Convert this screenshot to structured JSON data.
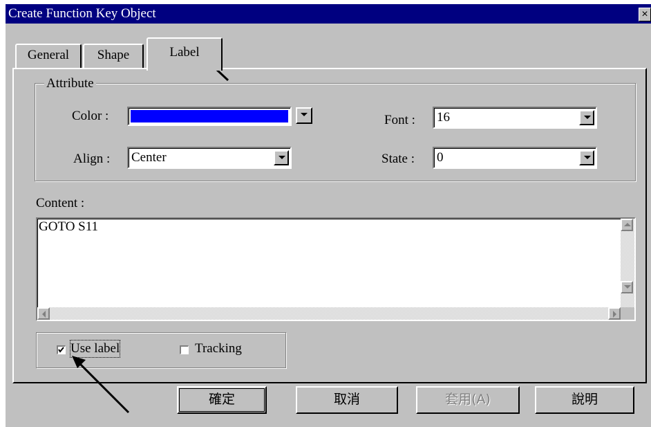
{
  "window": {
    "title": "Create Function Key Object",
    "close_glyph": "×"
  },
  "tabs": [
    {
      "label": "General"
    },
    {
      "label": "Shape"
    },
    {
      "label": "Label"
    }
  ],
  "attribute_group": {
    "title": "Attribute",
    "color_label": "Color :",
    "color_value": "#0000ff",
    "font_label": "Font :",
    "font_value": "16",
    "align_label": "Align :",
    "align_value": "Center",
    "state_label": "State :",
    "state_value": "0"
  },
  "content": {
    "label": "Content :",
    "text": "GOTO S11"
  },
  "options": {
    "use_label": {
      "label": "Use label",
      "checked": true
    },
    "tracking": {
      "label": "Tracking",
      "checked": false
    }
  },
  "buttons": {
    "ok": "確定",
    "cancel": "取消",
    "apply": "套用(A)",
    "help": "說明"
  },
  "icons": {
    "dropdown": "triangle-down-icon",
    "scroll_up": "triangle-up-icon",
    "scroll_down": "triangle-down-icon",
    "scroll_left": "triangle-left-icon",
    "scroll_right": "triangle-right-icon",
    "arrow": "annotation-arrow-icon"
  }
}
